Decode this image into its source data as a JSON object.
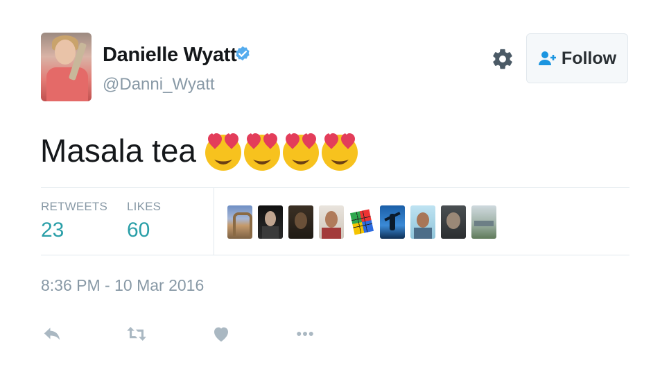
{
  "author": {
    "name": "Danielle Wyatt",
    "handle": "@Danni_Wyatt",
    "verified": true,
    "avatar_icon": "profile-photo"
  },
  "header": {
    "settings_icon": "gear-icon",
    "follow_label": "Follow",
    "follow_icon": "add-user-icon"
  },
  "tweet": {
    "text": "Masala tea",
    "emoji": [
      "heart-eyes-emoji",
      "heart-eyes-emoji",
      "heart-eyes-emoji",
      "heart-eyes-emoji"
    ]
  },
  "stats": {
    "retweets_label": "RETWEETS",
    "retweets_value": "23",
    "likes_label": "LIKES",
    "likes_value": "60",
    "likers_count_shown": 9
  },
  "timestamp": "8:36 PM - 10 Mar 2016",
  "actions": [
    "reply-icon",
    "retweet-icon",
    "like-icon",
    "more-icon"
  ],
  "colors": {
    "verified_blue": "#55acee",
    "secondary_text": "#8899a6",
    "stat_value": "#2a9fa8",
    "action_gray": "#aab8c2"
  }
}
